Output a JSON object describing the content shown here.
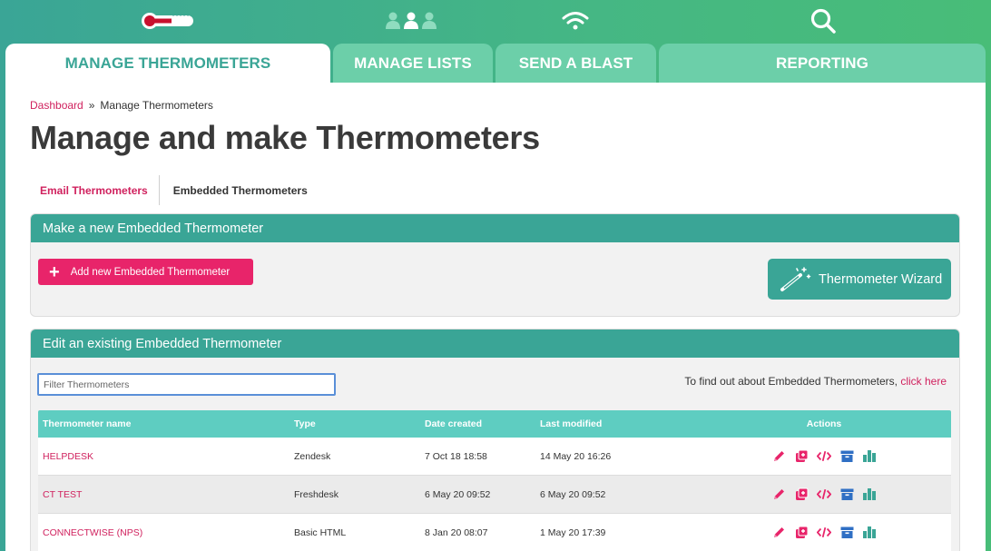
{
  "tabs": [
    {
      "label": "MANAGE THERMOMETERS",
      "active": true
    },
    {
      "label": "MANAGE LISTS",
      "active": false
    },
    {
      "label": "SEND A BLAST",
      "active": false
    },
    {
      "label": "REPORTING",
      "active": false
    }
  ],
  "breadcrumb": {
    "root": "Dashboard",
    "separator": "»",
    "current": "Manage Thermometers"
  },
  "page_title": "Manage and make Thermometers",
  "subtabs": {
    "email": "Email Thermometers",
    "embedded": "Embedded Thermometers"
  },
  "new_panel": {
    "title": "Make a new Embedded Thermometer",
    "add_button": "Add new Embedded Thermometer",
    "wizard_button": "Thermometer Wizard"
  },
  "edit_panel": {
    "title": "Edit an existing Embedded Thermometer",
    "filter_placeholder": "Filter Thermometers",
    "info_text": "To find out about Embedded Thermometers,",
    "info_link": "click here"
  },
  "table": {
    "headers": [
      "Thermometer name",
      "Type",
      "Date created",
      "Last modified",
      "Actions"
    ],
    "rows": [
      {
        "name": "HELPDESK",
        "type": "Zendesk",
        "created": "7 Oct 18 18:58",
        "modified": "14 May 20 16:26"
      },
      {
        "name": "CT TEST",
        "type": "Freshdesk",
        "created": "6 May 20 09:52",
        "modified": "6 May 20 09:52"
      },
      {
        "name": "CONNECTWISE (NPS)",
        "type": "Basic HTML",
        "created": "8 Jan 20 08:07",
        "modified": "1 May 20 17:39"
      }
    ]
  },
  "icons": {
    "top": [
      "thermometer-icon",
      "users-icon",
      "wifi-icon",
      "search-icon"
    ],
    "actions": [
      "edit-icon",
      "duplicate-icon",
      "embed-code-icon",
      "archive-icon",
      "report-icon"
    ]
  },
  "colors": {
    "teal": "#3aa596",
    "pink": "#e8246a",
    "link": "#d0215e",
    "table_header": "#5ecdc1",
    "archive": "#2f6fc4"
  }
}
